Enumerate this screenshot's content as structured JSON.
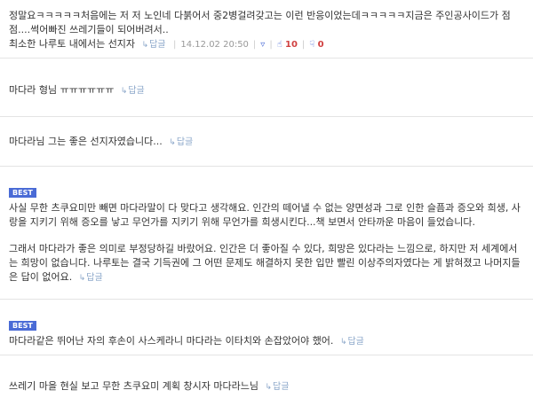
{
  "comments": [
    {
      "text_lines": [
        "정말요ㅋㅋㅋㅋㅋ처음에는 저 저 노인네 다붉어서 중2병걸려갖고는 이런 반응이었는데ㅋㅋㅋㅋㅋ지금은 주인공사이드가 점",
        "점....썩어빠진 쓰레기들이 되어버려서..",
        "최소한 나루토 내에서는 선지자"
      ],
      "reply": "답글",
      "date": "14.12.02 20:50",
      "likes": "10",
      "dislikes": "0"
    },
    {
      "text": "마다라 형님 ㅠㅠㅠㅠㅠㅠ",
      "reply": "답글"
    },
    {
      "text": "마다라님 그는 좋은 선지자였습니다...",
      "reply": "답글"
    },
    {
      "badge": "BEST",
      "para1": "사실 무한 츠쿠요미만 빼면 마다라말이 다 맞다고 생각해요. 인간의 떼어낼 수 없는 양면성과 그로 인한 슬픔과 증오와 희생, 사랑을 지키기 위해 증오를 낳고 무언가를 지키기 위해 무언가를 희생시킨다...책 보면서 안타까운 마음이 들었습니다.",
      "para2": "그래서 마다라가 좋은 의미로 부정당하길 바랐어요. 인간은 더 좋아질 수 있다, 희망은 있다라는 느낌으로, 하지만 저 세계에서는 희망이 없습니다. 나루토는 결국 기득권에 그 어떤 문제도 해결하지 못한 입만 빨린 이상주의자였다는 게 밝혀졌고 나머지들은 답이 없어요.",
      "reply": "답글"
    },
    {
      "badge": "BEST",
      "text": "마다라같은 뛰어난 자의 후손이 사스케라니 마다라는 이타치와 손잡았어야 했어.",
      "reply": "답글"
    },
    {
      "text": "쓰레기 마을 현실 보고 무한 츠쿠요미 계획 창시자 마다라느님",
      "reply": "답글"
    }
  ],
  "icons": {
    "reply_arrow": "↳",
    "user": "user-icon",
    "like": "thumbs-up-icon",
    "dislike": "thumbs-down-icon"
  },
  "colors": {
    "badge_bg": "#4a6bd6",
    "reply_link": "#8aa6c9",
    "count_red": "#d04040",
    "divider": "#e4e4e4"
  }
}
